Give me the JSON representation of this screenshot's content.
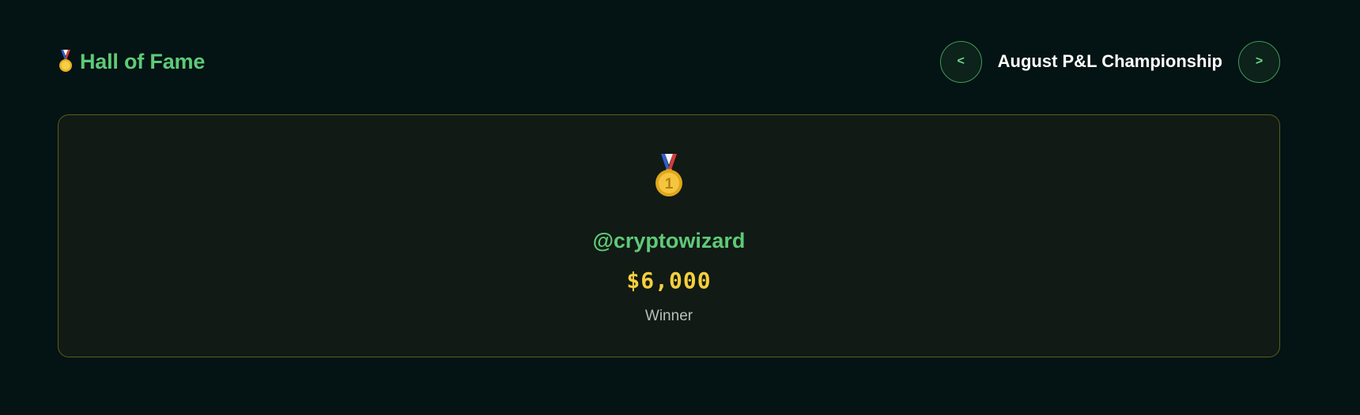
{
  "header": {
    "medal_icon": "sports-medal-icon",
    "title": "Hall of Fame"
  },
  "nav": {
    "prev_label": "<",
    "next_label": ">",
    "current_competition": "August P&L Championship"
  },
  "winner_card": {
    "medal_icon": "first-place-medal-icon",
    "medal_number": "1",
    "handle": "@cryptowizard",
    "prize": "$6,000",
    "label": "Winner"
  },
  "colors": {
    "background": "#041313",
    "accent_green": "#5fc977",
    "gold": "#f5cf3d",
    "card_border": "#595f1e"
  }
}
